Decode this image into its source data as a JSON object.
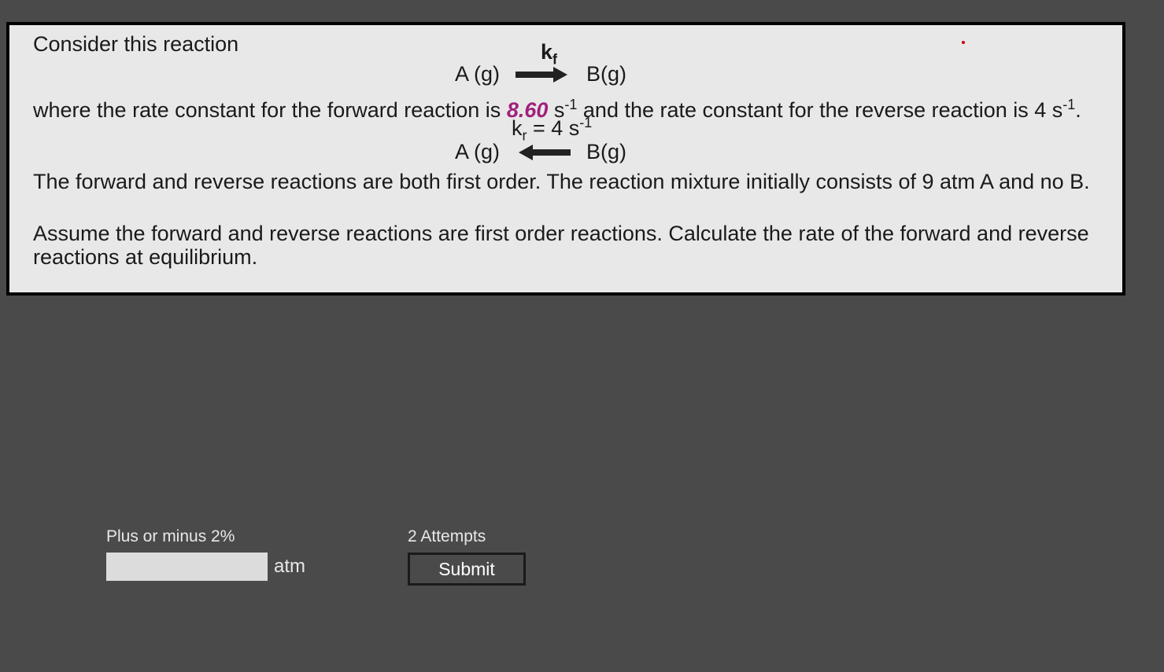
{
  "question": {
    "intro": "Consider this reaction",
    "reaction1": {
      "kf_label": "k",
      "kf_sub": "f",
      "left_species": "A (g)",
      "right_species": "B(g)"
    },
    "para1_before": "where the rate constant for the forward reaction is ",
    "kf_value": "8.60",
    "para1_mid": "  s",
    "para1_sup1": "-1",
    "para1_mid2": " and the rate constant for the reverse reaction is 4 s",
    "para1_sup2": "-1",
    "para1_end": ".",
    "reaction2": {
      "kr_label": "k",
      "kr_sub": "r",
      "kr_eq": " = 4 s",
      "kr_sup": "-1",
      "left_species": "A (g)",
      "right_species": "B(g)"
    },
    "para2": "The forward and reverse reactions are both first order. The reaction mixture initially consists of 9 atm A and no B.",
    "para3": "Assume the forward and reverse reactions are first order reactions.  Calculate the rate of the forward and reverse reactions at equilibrium."
  },
  "answer": {
    "tolerance_label": "Plus or minus 2%",
    "attempts_label": "2 Attempts",
    "unit": "atm",
    "submit_label": "Submit",
    "input_value": ""
  }
}
